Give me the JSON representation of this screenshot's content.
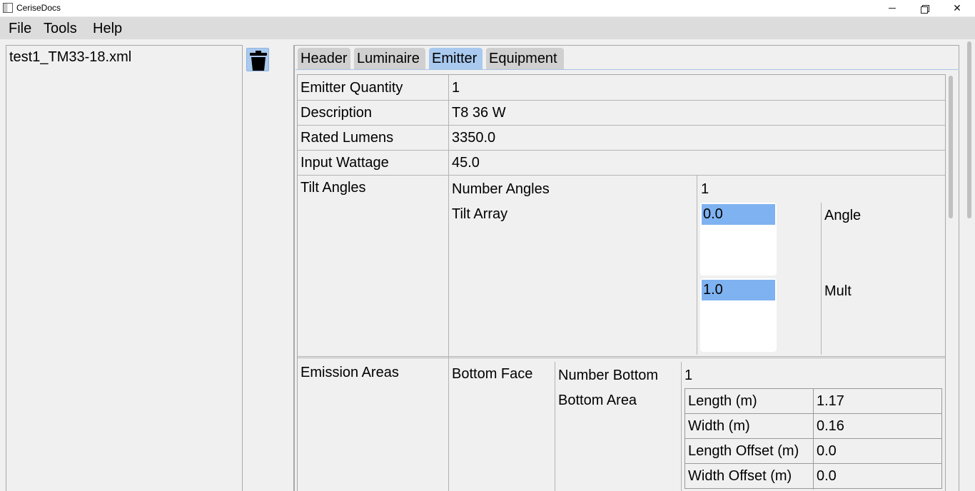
{
  "window": {
    "title": "CeriseDocs",
    "icons": {
      "app": "app-icon",
      "minimize": "minimize-icon",
      "maximize": "restore-icon",
      "close": "close-icon"
    }
  },
  "menu": {
    "file": "File",
    "tools": "Tools",
    "help": "Help"
  },
  "files": {
    "items": [
      "test1_TM33-18.xml"
    ],
    "delete_icon": "trash-icon"
  },
  "tabs": [
    {
      "label": "Header"
    },
    {
      "label": "Luminaire"
    },
    {
      "label": "Emitter",
      "active": true
    },
    {
      "label": "Equipment"
    }
  ],
  "emitter": {
    "quantity_label": "Emitter Quantity",
    "quantity": "1",
    "description_label": "Description",
    "description": "T8 36 W",
    "rated_lumens_label": "Rated Lumens",
    "rated_lumens": "3350.0",
    "input_wattage_label": "Input Wattage",
    "input_wattage": "45.0",
    "tilt": {
      "label": "Tilt Angles",
      "number_angles_label": "Number Angles",
      "number_angles": "1",
      "array_label": "Tilt Array",
      "angle_value": "0.0",
      "angle_label": "Angle",
      "mult_value": "1.0",
      "mult_label": "Mult"
    },
    "emission": {
      "label": "Emission Areas",
      "bottom_face_label": "Bottom Face",
      "number_bottom_label": "Number Bottom",
      "number_bottom": "1",
      "bottom_area_label": "Bottom Area",
      "area": [
        {
          "key": "Length (m)",
          "value": "1.17"
        },
        {
          "key": "Width (m)",
          "value": "0.16"
        },
        {
          "key": "Length Offset (m)",
          "value": "0.0"
        },
        {
          "key": "Width Offset (m)",
          "value": "0.0"
        }
      ]
    }
  },
  "colors": {
    "accent": "#a9c9ee",
    "selection": "#7fb2f0",
    "background": "#f0f0f0",
    "menubar": "#dcdcdc"
  }
}
